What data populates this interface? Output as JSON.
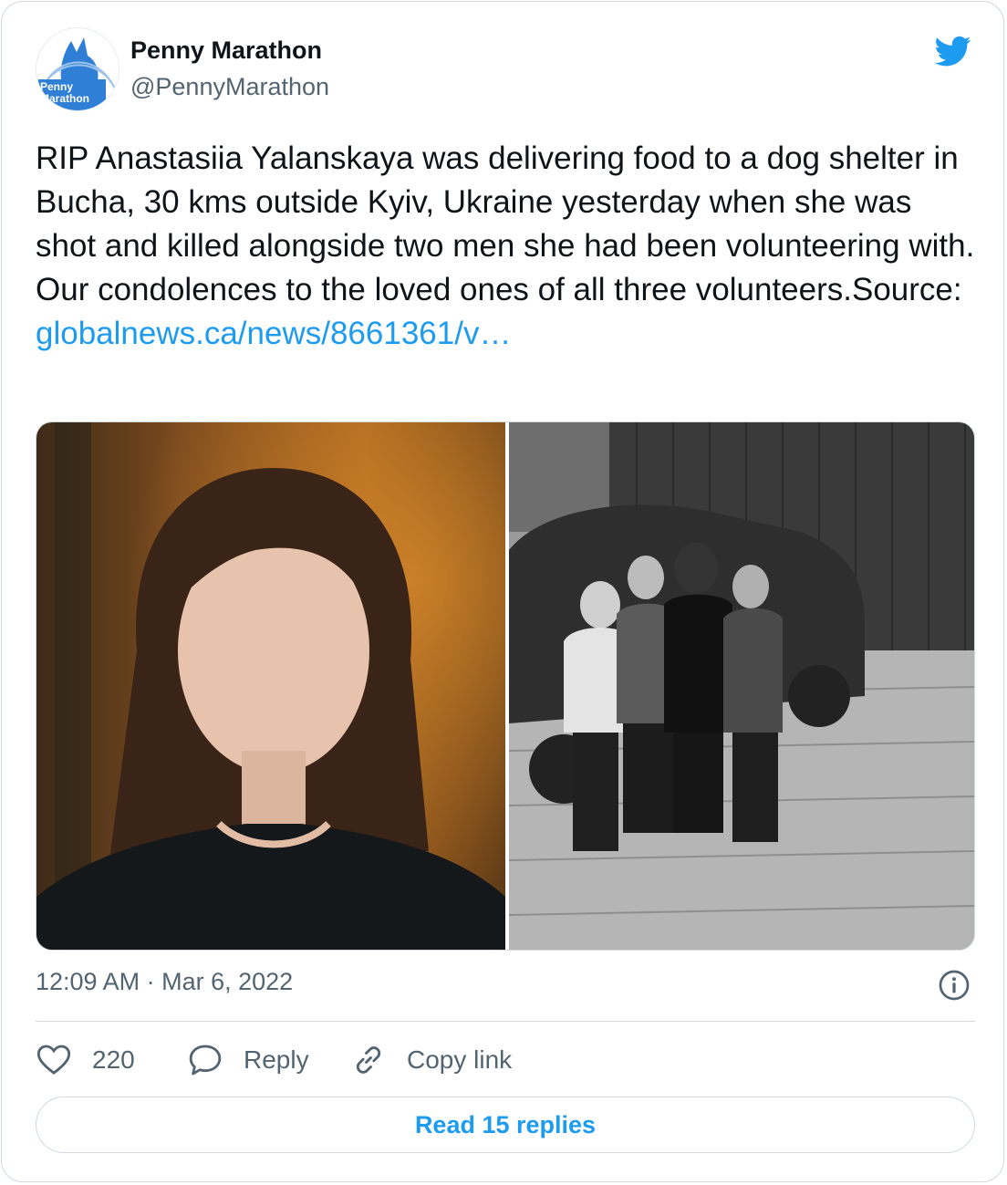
{
  "author": {
    "name": "Penny Marathon",
    "handle": "@PennyMarathon",
    "avatar_text": "Penny Marathon"
  },
  "tweet": {
    "text": "RIP Anastasiia Yalanskaya was delivering food to a dog shelter in Bucha, 30 kms outside Kyiv, Ukraine yesterday when she was shot and killed alongside two men she had been volunteering with. Our condolences to the loved ones of all three volunteers.Source:",
    "link_text": "globalnews.ca/news/8661361/v…"
  },
  "timestamp": "12:09 AM · Mar 6, 2022",
  "actions": {
    "like_count": "220",
    "reply_label": "Reply",
    "copy_link_label": "Copy link"
  },
  "read_replies_label": "Read 15 replies",
  "icons": {
    "brand": "twitter-bird-icon",
    "like": "heart-icon",
    "reply": "speech-bubble-icon",
    "copy": "link-icon",
    "info": "info-icon"
  },
  "colors": {
    "accent": "#1d9bf0",
    "text": "#0f1419",
    "secondary": "#536471",
    "border": "#cfd9de"
  }
}
